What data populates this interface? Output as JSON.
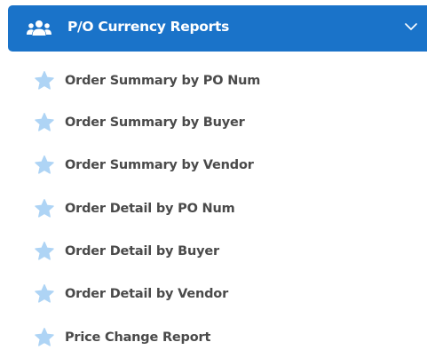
{
  "menu": {
    "title": "P/O Currency Reports",
    "header_icon": "users-icon",
    "expand_icon": "chevron-down-icon",
    "expanded": true,
    "colors": {
      "header_bg": "#1a73c9",
      "header_text": "#ffffff",
      "item_text": "#4a4a4a",
      "star_fill": "#aed4f5"
    },
    "items": [
      {
        "label": "Order Summary by PO Num",
        "icon": "star-icon"
      },
      {
        "label": "Order Summary by Buyer",
        "icon": "star-icon"
      },
      {
        "label": "Order Summary by Vendor",
        "icon": "star-icon"
      },
      {
        "label": "Order Detail by PO Num",
        "icon": "star-icon"
      },
      {
        "label": "Order Detail by Buyer",
        "icon": "star-icon"
      },
      {
        "label": "Order Detail by Vendor",
        "icon": "star-icon"
      },
      {
        "label": "Price Change Report",
        "icon": "star-icon"
      }
    ]
  }
}
